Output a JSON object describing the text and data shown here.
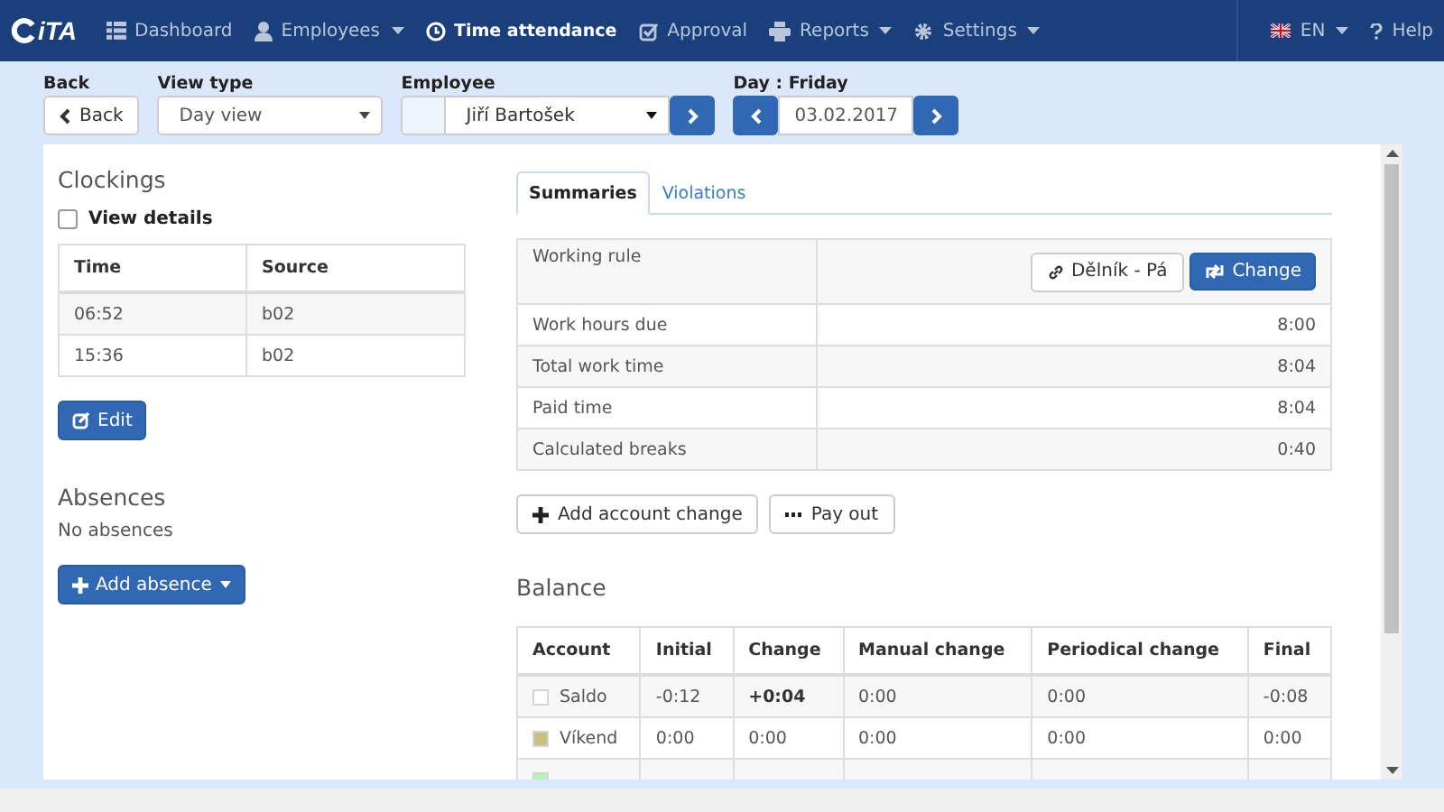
{
  "navbar": {
    "logo": "iTA",
    "items": [
      {
        "label": "Dashboard",
        "has_menu": false,
        "selected": false
      },
      {
        "label": "Employees",
        "has_menu": true,
        "selected": false
      },
      {
        "label": "Time attendance",
        "has_menu": false,
        "selected": true
      },
      {
        "label": "Approval",
        "has_menu": false,
        "selected": false
      },
      {
        "label": "Reports",
        "has_menu": true,
        "selected": false
      },
      {
        "label": "Settings",
        "has_menu": true,
        "selected": false
      }
    ],
    "language": "EN",
    "help": "Help"
  },
  "toolbar": {
    "back_label": "Back",
    "back_button": "Back",
    "view_type_label": "View type",
    "view_type": "Day view",
    "employee_label": "Employee",
    "employee": "Jiří Bartošek",
    "day_label": "Day : Friday",
    "date": "03.02.2017"
  },
  "clockings": {
    "title": "Clockings",
    "view_details": {
      "label": "View details",
      "checked": false
    },
    "columns": [
      "Time",
      "Source"
    ],
    "rows": [
      [
        "06:52",
        "b02"
      ],
      [
        "15:36",
        "b02"
      ]
    ],
    "edit_button": "Edit"
  },
  "absences": {
    "title": "Absences",
    "empty_text": "No absences",
    "add_button": "Add absence"
  },
  "tabs": [
    {
      "label": "Summaries",
      "selected": true
    },
    {
      "label": "Violations",
      "selected": false
    }
  ],
  "summaries": {
    "working_rule_label": "Working rule",
    "working_rule": "Dělník - Pá",
    "change_button": "Change",
    "rows": [
      {
        "label": "Work hours due",
        "value": "8:00"
      },
      {
        "label": "Total work time",
        "value": "8:04"
      },
      {
        "label": "Paid time",
        "value": "8:04"
      },
      {
        "label": "Calculated breaks",
        "value": "0:40"
      }
    ],
    "add_account_change": "Add account change",
    "pay_out": "Pay out"
  },
  "balance": {
    "title": "Balance",
    "columns": [
      "Account",
      "Initial",
      "Change",
      "Manual change",
      "Periodical change",
      "Final"
    ],
    "rows": [
      {
        "color": "#ffffff",
        "account": "Saldo",
        "initial": "-0:12",
        "change": "+0:04",
        "change_bold": true,
        "manual": "0:00",
        "periodical": "0:00",
        "final": "-0:08"
      },
      {
        "color": "#c9c080",
        "account": "Víkend",
        "initial": "0:00",
        "change": "0:00",
        "change_bold": false,
        "manual": "0:00",
        "periodical": "0:00",
        "final": "0:00"
      },
      {
        "color": "#b3f5b3"
      }
    ]
  }
}
